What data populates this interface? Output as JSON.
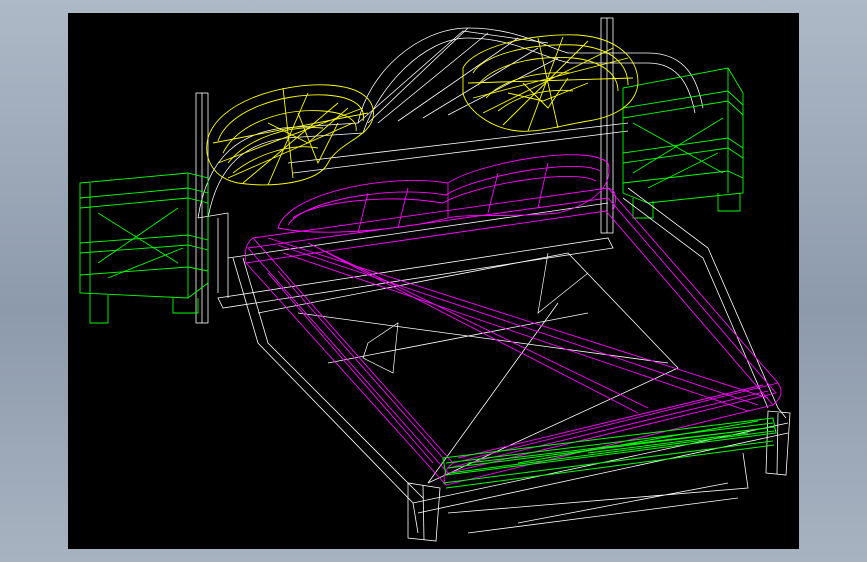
{
  "scene": {
    "background": "#000000",
    "colors": {
      "frame": "#ffffff",
      "pillows": "#ffff00",
      "mattress": "#ff00ff",
      "nightstands": "#00ff00",
      "footrail": "#00ff00"
    }
  }
}
